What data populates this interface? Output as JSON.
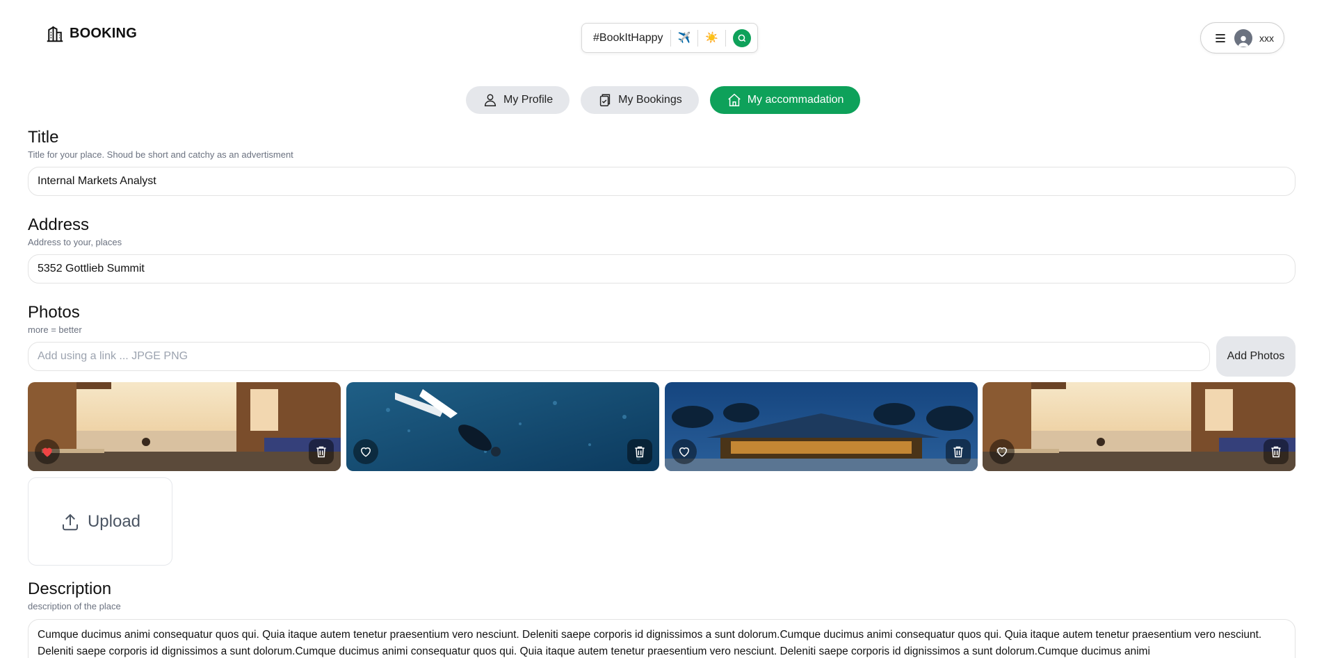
{
  "header": {
    "logo_text": "BOOKING",
    "search": {
      "hashtag": "#BookItHappy",
      "plane_emoji": "✈️",
      "sun_emoji": "☀️"
    },
    "user": {
      "name": "xxx"
    }
  },
  "tabs": [
    {
      "label": "My Profile",
      "active": false
    },
    {
      "label": "My Bookings",
      "active": false
    },
    {
      "label": "My accommadation",
      "active": true
    }
  ],
  "form": {
    "title": {
      "label": "Title",
      "hint": "Title for your place. Shoud be short and catchy as an advertisment",
      "value": "Internal Markets Analyst"
    },
    "address": {
      "label": "Address",
      "hint": "Address to your, places",
      "value": "5352 Gottlieb Summit"
    },
    "photos": {
      "label": "Photos",
      "hint": "more = better",
      "placeholder": "Add using a link ...    JPGE PNG",
      "add_button": "Add Photos",
      "upload_label": "Upload",
      "items": [
        {
          "subject": "overwater villa at sunset",
          "favorite": true
        },
        {
          "subject": "diver underwater with fish",
          "favorite": false
        },
        {
          "subject": "beach resort pavilion at night",
          "favorite": false
        },
        {
          "subject": "overwater villa at sunset",
          "favorite": false
        }
      ]
    },
    "description": {
      "label": "Description",
      "hint": "description of the place",
      "value": "Cumque ducimus animi consequatur quos qui. Quia itaque autem tenetur praesentium vero nesciunt. Deleniti saepe corporis id dignissimos a sunt dolorum.Cumque ducimus animi consequatur quos qui. Quia itaque autem tenetur praesentium vero nesciunt. Deleniti saepe corporis id dignissimos a sunt dolorum.Cumque ducimus animi consequatur quos qui. Quia itaque autem tenetur praesentium vero nesciunt. Deleniti saepe corporis id dignissimos a sunt dolorum.Cumque ducimus animi"
    }
  },
  "colors": {
    "accent": "#0ea15a",
    "tab_inactive": "#e5e7eb",
    "favorite": "#ef4444"
  }
}
